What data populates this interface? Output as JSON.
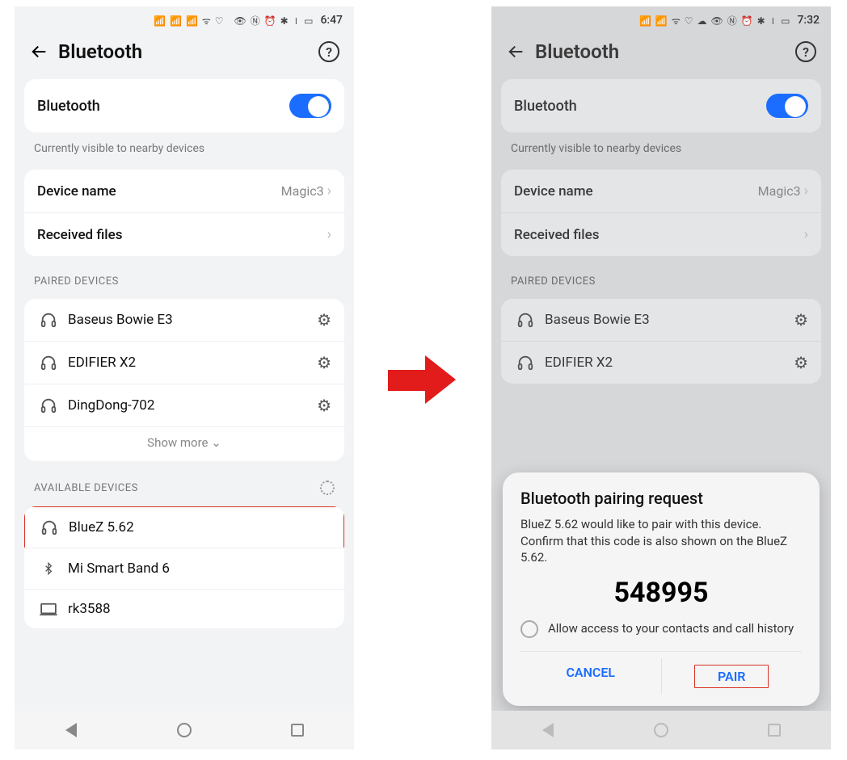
{
  "left": {
    "status_time": "6:47",
    "header": "Bluetooth",
    "bt_label": "Bluetooth",
    "visible_caption": "Currently visible to nearby devices",
    "device_name_label": "Device name",
    "device_name_value": "Magic3",
    "received_files_label": "Received files",
    "paired_title": "PAIRED DEVICES",
    "paired": [
      {
        "name": "Baseus Bowie E3",
        "icon": "headphones"
      },
      {
        "name": "EDIFIER X2",
        "icon": "headphones"
      },
      {
        "name": "DingDong-702",
        "icon": "headphones"
      }
    ],
    "show_more": "Show more",
    "available_title": "AVAILABLE DEVICES",
    "available": [
      {
        "name": "BlueZ 5.62",
        "icon": "headphones",
        "highlight": true
      },
      {
        "name": "Mi Smart Band 6",
        "icon": "bluetooth"
      },
      {
        "name": "rk3588",
        "icon": "laptop"
      }
    ]
  },
  "right": {
    "status_time": "7:32",
    "header": "Bluetooth",
    "bt_label": "Bluetooth",
    "visible_caption": "Currently visible to nearby devices",
    "device_name_label": "Device name",
    "device_name_value": "Magic3",
    "received_files_label": "Received files",
    "paired_title": "PAIRED DEVICES",
    "paired": [
      {
        "name": "Baseus Bowie E3",
        "icon": "headphones"
      },
      {
        "name": "EDIFIER X2",
        "icon": "headphones"
      }
    ],
    "dialog": {
      "title": "Bluetooth pairing request",
      "body": "BlueZ 5.62 would like to pair with this device. Confirm that this code is also shown on the BlueZ 5.62.",
      "code": "548995",
      "allow": "Allow access to your contacts and call history",
      "cancel": "CANCEL",
      "pair": "PAIR"
    }
  }
}
